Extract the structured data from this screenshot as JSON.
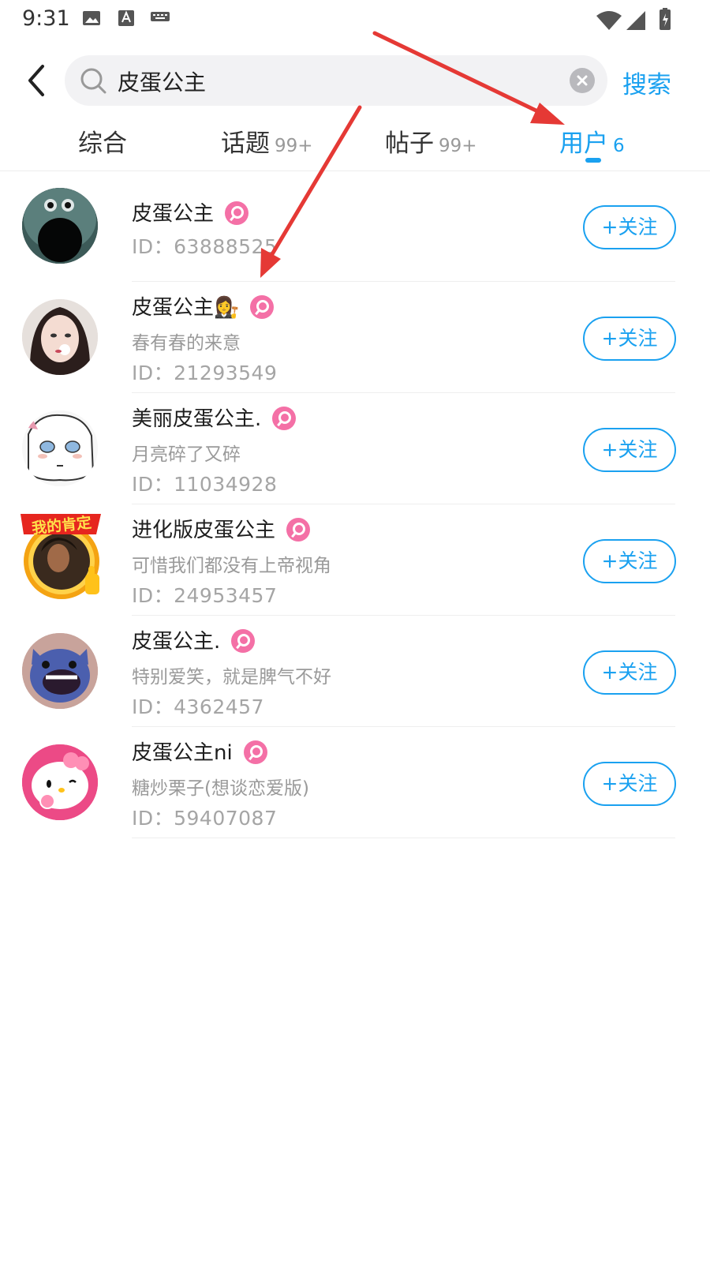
{
  "status_bar": {
    "time": "9:31"
  },
  "search": {
    "query": "皮蛋公主",
    "button_label": "搜索"
  },
  "tabs": [
    {
      "label": "综合",
      "count": ""
    },
    {
      "label": "话题",
      "count": "99+"
    },
    {
      "label": "帖子",
      "count": "99+"
    },
    {
      "label": "用户",
      "count": "6"
    }
  ],
  "active_tab": "用户",
  "users": [
    {
      "name": "皮蛋公主",
      "emoji": "",
      "bio": "",
      "id_text": "ID：63888525",
      "follow_label": "+关注"
    },
    {
      "name": "皮蛋公主",
      "emoji": "👩‍⚖️",
      "bio": "春有春的来意",
      "id_text": "ID：21293549",
      "follow_label": "+关注"
    },
    {
      "name": "美丽皮蛋公主.",
      "emoji": "",
      "bio": "月亮碎了又碎",
      "id_text": "ID：11034928",
      "follow_label": "+关注"
    },
    {
      "name": "进化版皮蛋公主",
      "emoji": "",
      "bio": "可惜我们都没有上帝视角",
      "id_text": "ID：24953457",
      "follow_label": "+关注"
    },
    {
      "name": "皮蛋公主.",
      "emoji": "",
      "bio": "特别爱笑，就是脾气不好",
      "id_text": "ID：4362457",
      "follow_label": "+关注"
    },
    {
      "name": "皮蛋公主ni",
      "emoji": "",
      "bio": "糖炒栗子(想谈恋爱版)",
      "id_text": "ID：59407087",
      "follow_label": "+关注"
    }
  ],
  "avatar_badge_text": "我的肯定",
  "colors": {
    "accent": "#1aa1f0",
    "female_badge": "#f470a6",
    "annotation_arrow": "#e53935"
  }
}
